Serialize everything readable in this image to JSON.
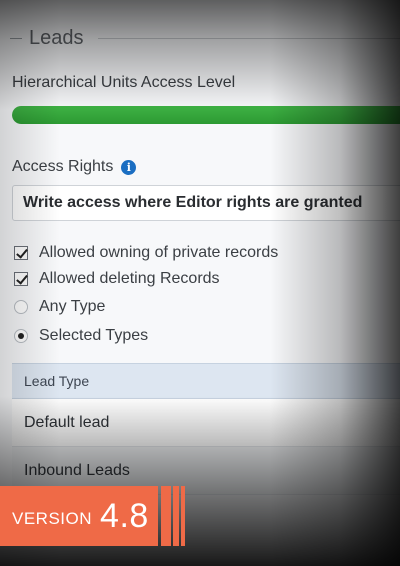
{
  "section": {
    "title": "Leads"
  },
  "hierarchy": {
    "label": "Hierarchical Units Access Level",
    "progress_fraction": 1.0,
    "progress_color": "#34a83a"
  },
  "access_rights": {
    "label": "Access Rights",
    "info_icon": "info-icon",
    "selected_value": "Write access where Editor rights are granted"
  },
  "options": {
    "owning": {
      "label": "Allowed owning of private records",
      "checked": true
    },
    "deleting": {
      "label": "Allowed deleting Records",
      "checked": true
    },
    "any_type": {
      "label": "Any Type",
      "selected": false
    },
    "selected_types": {
      "label": "Selected Types",
      "selected": true
    }
  },
  "table": {
    "header": "Lead Type",
    "rows": [
      "Default lead",
      "Inbound Leads"
    ]
  },
  "badge": {
    "word": "VERSION",
    "number": "4.8",
    "color": "#ef6a47"
  }
}
